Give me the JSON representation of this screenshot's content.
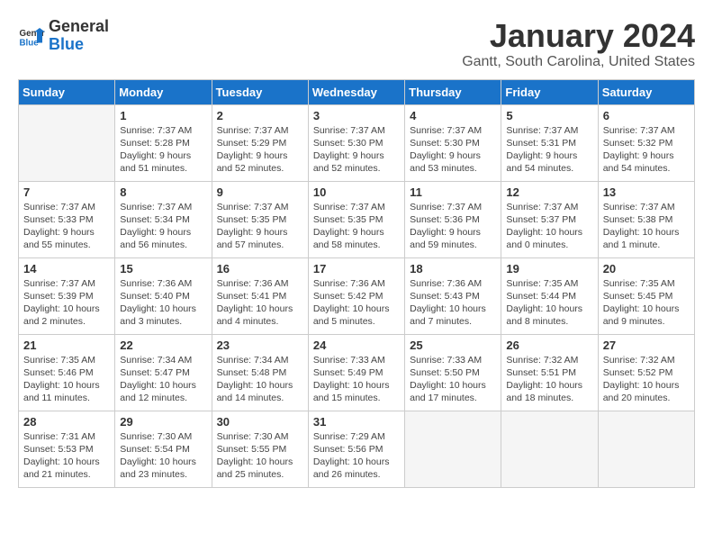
{
  "header": {
    "logo_line1": "General",
    "logo_line2": "Blue",
    "month_year": "January 2024",
    "location": "Gantt, South Carolina, United States"
  },
  "days_of_week": [
    "Sunday",
    "Monday",
    "Tuesday",
    "Wednesday",
    "Thursday",
    "Friday",
    "Saturday"
  ],
  "weeks": [
    [
      {
        "day": "",
        "content": ""
      },
      {
        "day": "1",
        "content": "Sunrise: 7:37 AM\nSunset: 5:28 PM\nDaylight: 9 hours\nand 51 minutes."
      },
      {
        "day": "2",
        "content": "Sunrise: 7:37 AM\nSunset: 5:29 PM\nDaylight: 9 hours\nand 52 minutes."
      },
      {
        "day": "3",
        "content": "Sunrise: 7:37 AM\nSunset: 5:30 PM\nDaylight: 9 hours\nand 52 minutes."
      },
      {
        "day": "4",
        "content": "Sunrise: 7:37 AM\nSunset: 5:30 PM\nDaylight: 9 hours\nand 53 minutes."
      },
      {
        "day": "5",
        "content": "Sunrise: 7:37 AM\nSunset: 5:31 PM\nDaylight: 9 hours\nand 54 minutes."
      },
      {
        "day": "6",
        "content": "Sunrise: 7:37 AM\nSunset: 5:32 PM\nDaylight: 9 hours\nand 54 minutes."
      }
    ],
    [
      {
        "day": "7",
        "content": "Sunrise: 7:37 AM\nSunset: 5:33 PM\nDaylight: 9 hours\nand 55 minutes."
      },
      {
        "day": "8",
        "content": "Sunrise: 7:37 AM\nSunset: 5:34 PM\nDaylight: 9 hours\nand 56 minutes."
      },
      {
        "day": "9",
        "content": "Sunrise: 7:37 AM\nSunset: 5:35 PM\nDaylight: 9 hours\nand 57 minutes."
      },
      {
        "day": "10",
        "content": "Sunrise: 7:37 AM\nSunset: 5:35 PM\nDaylight: 9 hours\nand 58 minutes."
      },
      {
        "day": "11",
        "content": "Sunrise: 7:37 AM\nSunset: 5:36 PM\nDaylight: 9 hours\nand 59 minutes."
      },
      {
        "day": "12",
        "content": "Sunrise: 7:37 AM\nSunset: 5:37 PM\nDaylight: 10 hours\nand 0 minutes."
      },
      {
        "day": "13",
        "content": "Sunrise: 7:37 AM\nSunset: 5:38 PM\nDaylight: 10 hours\nand 1 minute."
      }
    ],
    [
      {
        "day": "14",
        "content": "Sunrise: 7:37 AM\nSunset: 5:39 PM\nDaylight: 10 hours\nand 2 minutes."
      },
      {
        "day": "15",
        "content": "Sunrise: 7:36 AM\nSunset: 5:40 PM\nDaylight: 10 hours\nand 3 minutes."
      },
      {
        "day": "16",
        "content": "Sunrise: 7:36 AM\nSunset: 5:41 PM\nDaylight: 10 hours\nand 4 minutes."
      },
      {
        "day": "17",
        "content": "Sunrise: 7:36 AM\nSunset: 5:42 PM\nDaylight: 10 hours\nand 5 minutes."
      },
      {
        "day": "18",
        "content": "Sunrise: 7:36 AM\nSunset: 5:43 PM\nDaylight: 10 hours\nand 7 minutes."
      },
      {
        "day": "19",
        "content": "Sunrise: 7:35 AM\nSunset: 5:44 PM\nDaylight: 10 hours\nand 8 minutes."
      },
      {
        "day": "20",
        "content": "Sunrise: 7:35 AM\nSunset: 5:45 PM\nDaylight: 10 hours\nand 9 minutes."
      }
    ],
    [
      {
        "day": "21",
        "content": "Sunrise: 7:35 AM\nSunset: 5:46 PM\nDaylight: 10 hours\nand 11 minutes."
      },
      {
        "day": "22",
        "content": "Sunrise: 7:34 AM\nSunset: 5:47 PM\nDaylight: 10 hours\nand 12 minutes."
      },
      {
        "day": "23",
        "content": "Sunrise: 7:34 AM\nSunset: 5:48 PM\nDaylight: 10 hours\nand 14 minutes."
      },
      {
        "day": "24",
        "content": "Sunrise: 7:33 AM\nSunset: 5:49 PM\nDaylight: 10 hours\nand 15 minutes."
      },
      {
        "day": "25",
        "content": "Sunrise: 7:33 AM\nSunset: 5:50 PM\nDaylight: 10 hours\nand 17 minutes."
      },
      {
        "day": "26",
        "content": "Sunrise: 7:32 AM\nSunset: 5:51 PM\nDaylight: 10 hours\nand 18 minutes."
      },
      {
        "day": "27",
        "content": "Sunrise: 7:32 AM\nSunset: 5:52 PM\nDaylight: 10 hours\nand 20 minutes."
      }
    ],
    [
      {
        "day": "28",
        "content": "Sunrise: 7:31 AM\nSunset: 5:53 PM\nDaylight: 10 hours\nand 21 minutes."
      },
      {
        "day": "29",
        "content": "Sunrise: 7:30 AM\nSunset: 5:54 PM\nDaylight: 10 hours\nand 23 minutes."
      },
      {
        "day": "30",
        "content": "Sunrise: 7:30 AM\nSunset: 5:55 PM\nDaylight: 10 hours\nand 25 minutes."
      },
      {
        "day": "31",
        "content": "Sunrise: 7:29 AM\nSunset: 5:56 PM\nDaylight: 10 hours\nand 26 minutes."
      },
      {
        "day": "",
        "content": ""
      },
      {
        "day": "",
        "content": ""
      },
      {
        "day": "",
        "content": ""
      }
    ]
  ]
}
